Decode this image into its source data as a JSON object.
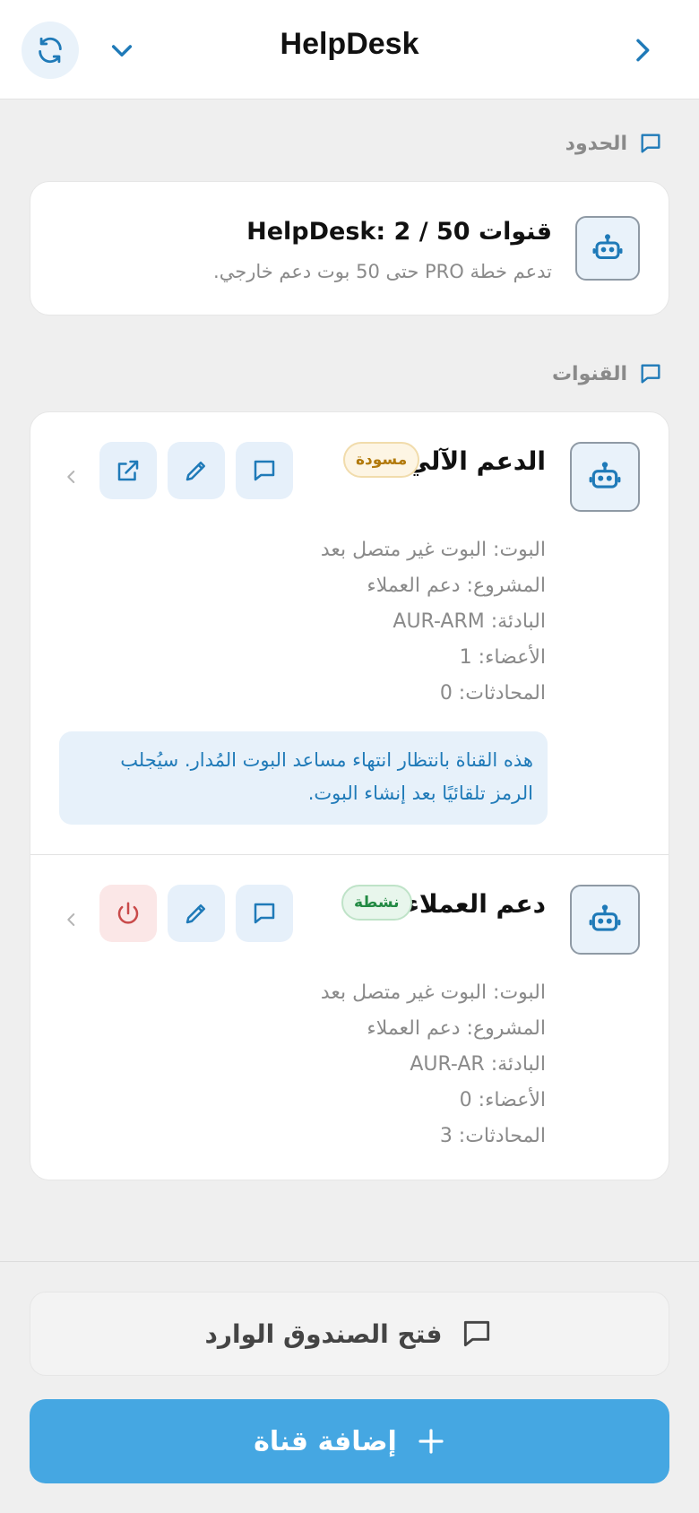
{
  "header": {
    "title": "HelpDesk",
    "icons": [
      "refresh-icon",
      "chevron-down-icon",
      "chevron-right-icon"
    ]
  },
  "limits_section": {
    "label": "الحدود",
    "card": {
      "title": "قنوات HelpDesk: 2 / 50",
      "subtitle": "تدعم خطة PRO حتى 50 بوت دعم خارجي."
    }
  },
  "channels_section": {
    "label": "القنوات",
    "channels": [
      {
        "name": "الدعم الآلي",
        "status": "مسودة",
        "details": [
          "البوت: البوت غير متصل بعد",
          "المشروع: دعم العملاء",
          "البادئة: AUR-ARM",
          "الأعضاء: 1",
          "المحادثات: 0"
        ],
        "notice_line1": "هذه القناة بانتظار انتهاء مساعد البوت المُدار. سيُجلب",
        "notice_line2": "الرمز تلقائيًا بعد إنشاء البوت.",
        "actions": [
          "chat-icon",
          "edit-icon",
          "external-link-icon"
        ]
      },
      {
        "name": "دعم العملاء",
        "status": "نشطة",
        "details": [
          "البوت: البوت غير متصل بعد",
          "المشروع: دعم العملاء",
          "البادئة: AUR-AR",
          "الأعضاء: 0",
          "المحادثات: 3"
        ],
        "actions": [
          "chat-icon",
          "edit-icon",
          "power-icon"
        ]
      }
    ]
  },
  "footer": {
    "open_inbox_label": "فتح الصندوق الوارد",
    "add_channel_label": "إضافة قناة"
  },
  "colors": {
    "accent": "#1f7ab8",
    "primary_button": "#45a7e2",
    "draft_badge": "#b27a0c",
    "active_badge": "#238a44",
    "danger": "#c94a4a"
  }
}
